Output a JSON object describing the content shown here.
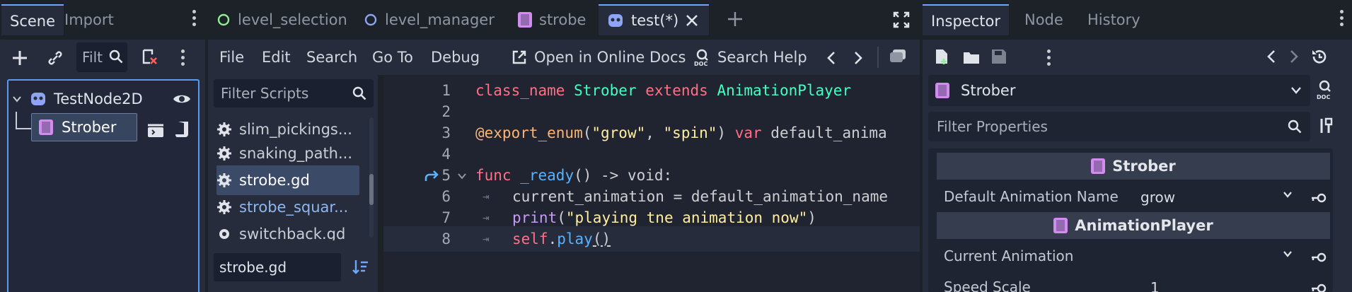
{
  "left_dock": {
    "tabs": [
      "Scene",
      "Import"
    ],
    "filter_placeholder": "Filt",
    "tree": {
      "root": "TestNode2D",
      "child": "Strober"
    }
  },
  "editor_tabs": [
    {
      "label": "level_selection",
      "icon": "circle-icon-green"
    },
    {
      "label": "level_manager",
      "icon": "circle-icon-blue"
    },
    {
      "label": "strobe",
      "icon": "anim-player-icon"
    },
    {
      "label": "test(*)",
      "icon": "godot-icon"
    }
  ],
  "menu": {
    "file": "File",
    "edit": "Edit",
    "search": "Search",
    "goto": "Go To",
    "debug": "Debug",
    "online_docs": "Open in Online Docs",
    "search_help": "Search Help"
  },
  "scripts_panel": {
    "filter_placeholder": "Filter Scripts",
    "items": [
      "slim_pickings...",
      "snaking_path...",
      "strobe.gd",
      "strobe_squar...",
      "switchback.gd"
    ],
    "selected_index": 2,
    "current_file": "strobe.gd"
  },
  "code": {
    "line_numbers": [
      "1",
      "2",
      "3",
      "4",
      "5",
      "6",
      "7",
      "8"
    ],
    "l1": {
      "kw1": "class_name",
      "cls1": "Strober",
      "kw2": "extends",
      "cls2": "AnimationPlayer"
    },
    "l3": {
      "ann": "@export_enum",
      "p1": "(",
      "s1": "\"grow\"",
      "c": ", ",
      "s2": "\"spin\"",
      "p2": ")",
      "kw": "var",
      "rest": "default_anima"
    },
    "l5": {
      "kw": "func",
      "fn": "_ready",
      "rest": "() -> void:"
    },
    "l6": {
      "text": "current_animation = default_animation_name"
    },
    "l7": {
      "fn": "print",
      "p1": "(",
      "str": "\"playing tne animation now\"",
      "p2": ")"
    },
    "l8": {
      "kw": "self",
      "dot": ".",
      "fn": "play",
      "paren": "()"
    }
  },
  "inspector": {
    "tabs": [
      "Inspector",
      "Node",
      "History"
    ],
    "object_name": "Strober",
    "filter_placeholder": "Filter Properties",
    "sections": [
      {
        "title": "Strober",
        "props": [
          {
            "label": "Default Animation Name",
            "value": "grow"
          }
        ]
      },
      {
        "title": "AnimationPlayer",
        "props": [
          {
            "label": "Current Animation",
            "value": ""
          },
          {
            "label": "Speed Scale",
            "value": "1"
          }
        ]
      }
    ]
  },
  "colors": {
    "accent": "#6ea6ff",
    "keyword": "#ff7085",
    "class": "#42ffc2",
    "string": "#ffeda1",
    "function": "#57b3ff",
    "annotation": "#ffb373"
  }
}
